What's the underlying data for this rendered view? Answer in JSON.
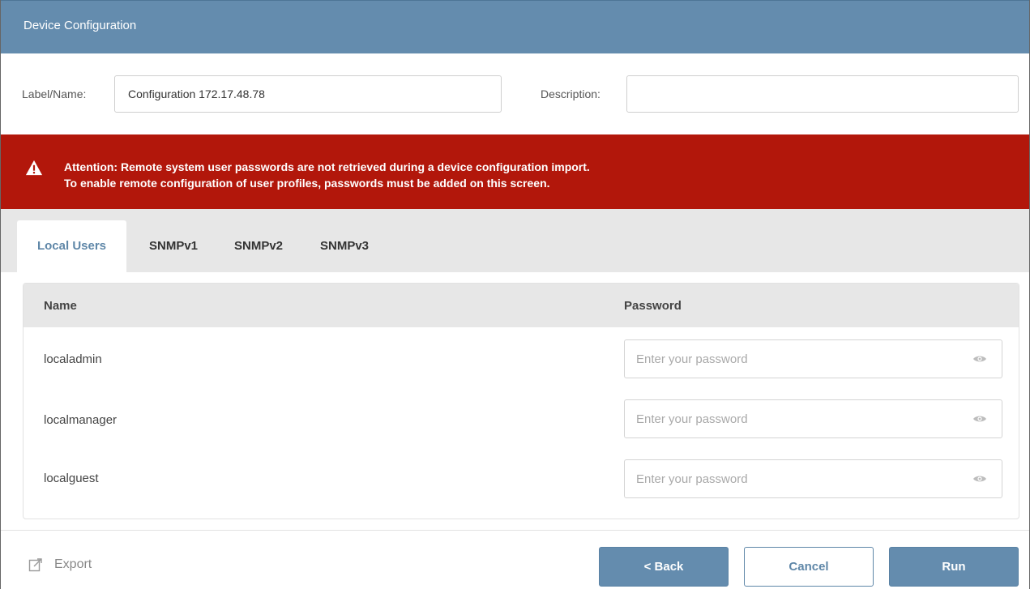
{
  "window": {
    "title": "Device Configuration"
  },
  "form": {
    "label_name_label": "Label/Name:",
    "label_name_value": "Configuration 172.17.48.78",
    "description_label": "Description:",
    "description_value": ""
  },
  "alert": {
    "line1": "Attention: Remote system user passwords are not retrieved during a device configuration import.",
    "line2": "To enable remote configuration of user profiles, passwords must be added on this screen.",
    "icon": "warning-triangle-icon",
    "color": "#b2170b"
  },
  "tabs": [
    {
      "label": "Local Users",
      "active": true
    },
    {
      "label": "SNMPv1",
      "active": false
    },
    {
      "label": "SNMPv2",
      "active": false
    },
    {
      "label": "SNMPv3",
      "active": false
    }
  ],
  "table": {
    "columns": [
      "Name",
      "Password"
    ],
    "rows": [
      {
        "name": "localadmin",
        "password": "",
        "placeholder": "Enter your password"
      },
      {
        "name": "localmanager",
        "password": "",
        "placeholder": "Enter your password"
      },
      {
        "name": "localguest",
        "password": "",
        "placeholder": "Enter your password"
      }
    ]
  },
  "footer": {
    "export_label": "Export",
    "back_label": "< Back",
    "cancel_label": "Cancel",
    "run_label": "Run"
  },
  "colors": {
    "accent": "#648cae",
    "alert": "#b2170b",
    "tab_bg": "#e7e7e7"
  }
}
